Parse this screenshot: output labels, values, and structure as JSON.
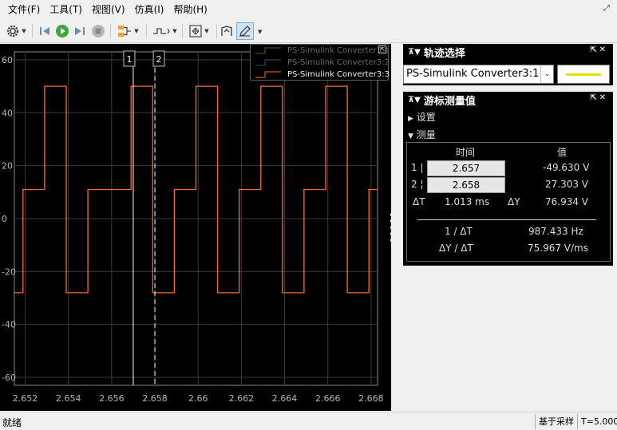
{
  "menu": [
    "文件(F)",
    "工具(T)",
    "视图(V)",
    "仿真(I)",
    "帮助(H)"
  ],
  "toolbar": {
    "icons": [
      "gear-icon",
      "step-back-icon",
      "run-icon",
      "step-forward-icon",
      "stop-icon",
      "signal-select-icon",
      "trigger-icon",
      "zoom-fit-icon",
      "axes-scaling-icon",
      "cursor-measure-icon"
    ]
  },
  "plot": {
    "cursor1_label": "1",
    "cursor2_label": "2",
    "x_ticks": [
      "2.652",
      "2.654",
      "2.656",
      "2.658",
      "2.66",
      "2.662",
      "2.664",
      "2.666",
      "2.668"
    ],
    "y_ticks": [
      "60",
      "40",
      "20",
      "0",
      "-20",
      "-40",
      "-60"
    ]
  },
  "legend": {
    "items": [
      {
        "label": "PS-Simulink Converter3:1",
        "color": "#e8e000",
        "active": false
      },
      {
        "label": "PS-Simulink Converter3:2",
        "color": "#3a7fd6",
        "active": false
      },
      {
        "label": "PS-Simulink Converter3:3",
        "color": "#ff6a2a",
        "active": true
      }
    ]
  },
  "trace_panel": {
    "title": "轨迹选择",
    "selected": "PS-Simulink Converter3:1",
    "line_color": "#e8e000"
  },
  "meas_panel": {
    "title": "游标测量值",
    "settings_label": "设置",
    "measure_label": "测量",
    "col_time": "时间",
    "col_value": "值",
    "row1_label": "1 |",
    "row1_time": "2.657",
    "row1_value": "-49.630 V",
    "row2_label": "2 ¦",
    "row2_time": "2.658",
    "row2_value": "27.303 V",
    "dt_label": "ΔT",
    "dt_value": "1.013 ms",
    "dy_label": "ΔY",
    "dy_value": "76.934 V",
    "inv_dt_label": "1 / ΔT",
    "inv_dt_value": "987.433 Hz",
    "slope_label": "ΔY / ΔT",
    "slope_value": "75.967 V/ms"
  },
  "status": {
    "left": "就绪",
    "mode": "基于采样",
    "time": "T=5.000"
  },
  "chart_data": {
    "type": "line",
    "xlim": [
      2.6515,
      2.6683
    ],
    "ylim": [
      -63,
      63
    ],
    "grid": true,
    "series": [
      {
        "name": "PS-Simulink Converter3:3",
        "color": "#ff6a2a",
        "x": [
          2.6515,
          2.6519,
          2.6519,
          2.6529,
          2.6529,
          2.6539,
          2.6539,
          2.6549,
          2.6549,
          2.6569,
          2.6569,
          2.6579,
          2.6579,
          2.6589,
          2.6589,
          2.6599,
          2.6599,
          2.6609,
          2.6609,
          2.6619,
          2.6619,
          2.6629,
          2.6629,
          2.6639,
          2.6639,
          2.6649,
          2.6649,
          2.6659,
          2.6659,
          2.6669,
          2.6669,
          2.6679,
          2.6679,
          2.6683
        ],
        "y": [
          -28,
          -28,
          11,
          11,
          50,
          50,
          -28,
          -28,
          11,
          11,
          50,
          50,
          -28,
          -28,
          11,
          11,
          50,
          50,
          -28,
          -28,
          11,
          11,
          50,
          50,
          -28,
          -28,
          11,
          11,
          50,
          50,
          -28,
          -28,
          11,
          11
        ]
      }
    ],
    "cursors": [
      2.657,
      2.658
    ]
  }
}
